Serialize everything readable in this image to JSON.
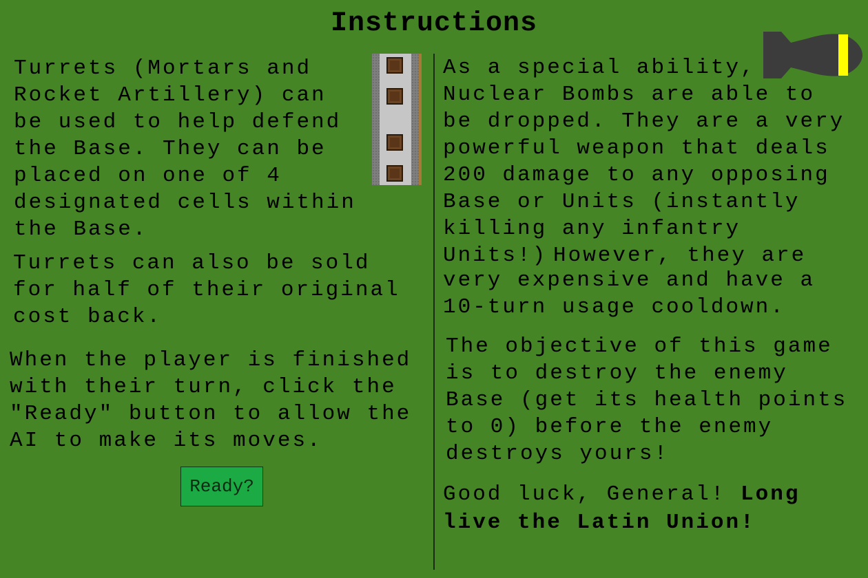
{
  "title": "Instructions",
  "left": {
    "turrets_text": "Turrets (Mortars and\nRocket Artillery) can\nbe used to help defend\nthe Base. They can be\nplaced on one of 4\ndesignated cells within\nthe Base.",
    "sell_text": "Turrets can also be sold\nfor half of their original\ncost back.",
    "ready_text": "When the player is finished\nwith their turn, click the\n\"Ready\" button to allow the\nAI to make its moves.",
    "ready_button_label": "Ready?"
  },
  "right": {
    "nuke_text": "As a special ability,\nNuclear Bombs are able to\nbe dropped. They are a very\npowerful weapon that deals\n200 damage to any opposing\nBase or Units (instantly\nkilling any infantry\nUnits!)",
    "nuke_text_2": "However, they are",
    "nuke_text_3": "very expensive and have a\n10-turn usage cooldown.",
    "objective_text": "The objective of this game\nis to destroy the enemy\nBase (get its health points\nto 0) before the enemy\ndestroys yours!",
    "good_luck_text": "Good luck, General! ",
    "good_luck_bold_1": "Long",
    "good_luck_bold_2": "live the Latin Union!"
  },
  "icons": {
    "base": "base-turret-cells-icon",
    "bomb": "nuclear-bomb-icon"
  },
  "colors": {
    "background": "#458526",
    "button": "#1caa45",
    "bomb_body": "#3c3c3c",
    "bomb_band": "#ffff00"
  }
}
